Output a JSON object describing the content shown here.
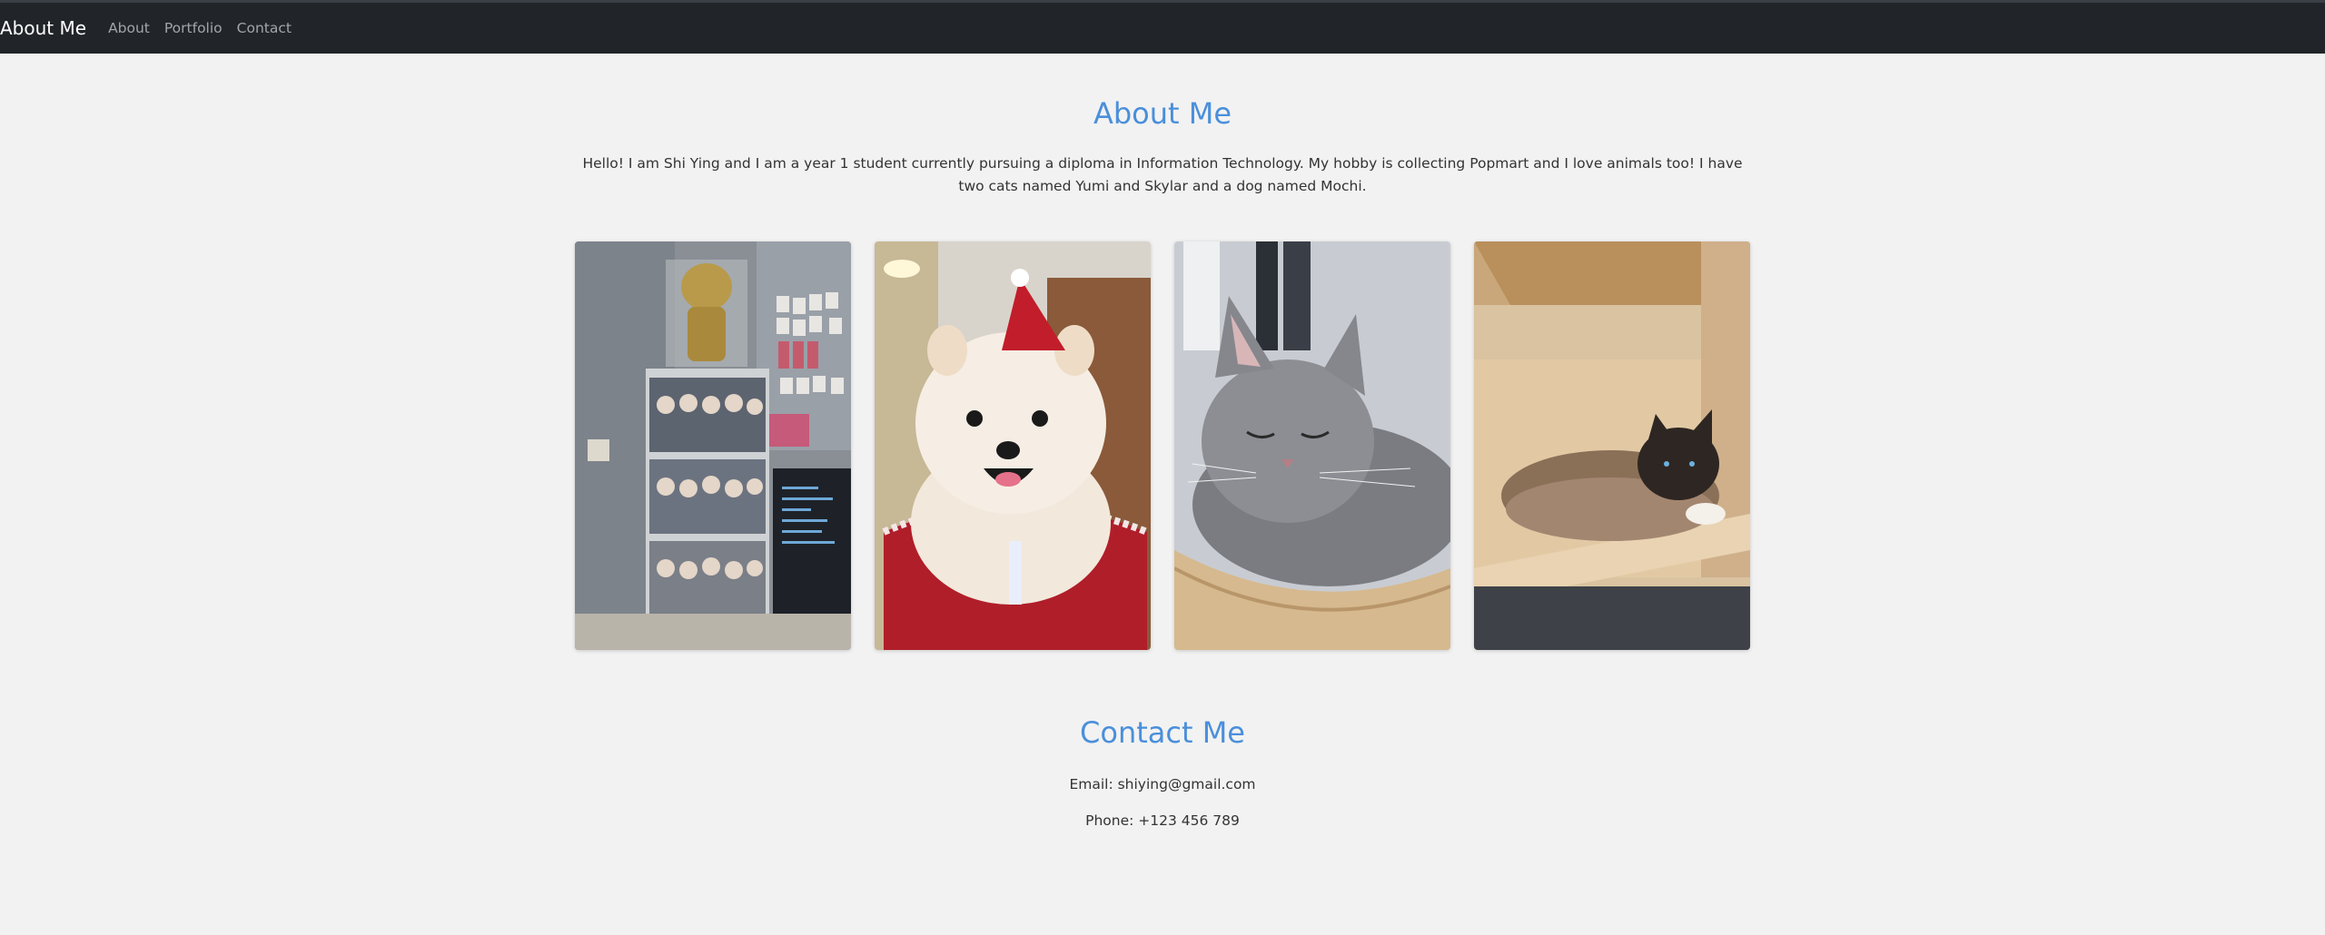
{
  "navbar": {
    "brand": "About Me",
    "links": [
      "About",
      "Portfolio",
      "Contact"
    ]
  },
  "about": {
    "title": "About Me",
    "bio": "Hello! I am Shi Ying and I am a year 1 student currently pursuing a diploma in Information Technology. My hobby is collecting Popmart and I love animals too! I have two cats named Yumi and Skylar and a dog named Mochi."
  },
  "gallery": {
    "images": [
      {
        "subject": "popmart-collection-shelf"
      },
      {
        "subject": "pomeranian-dog-mochi"
      },
      {
        "subject": "grey-cat"
      },
      {
        "subject": "siamese-cat"
      }
    ]
  },
  "contact": {
    "title": "Contact Me",
    "email": "Email: shiying@gmail.com",
    "phone": "Phone: +123 456 789"
  },
  "colors": {
    "navbar_bg": "#212529",
    "heading": "#4a8fdb",
    "page_bg": "#f2f2f2"
  }
}
